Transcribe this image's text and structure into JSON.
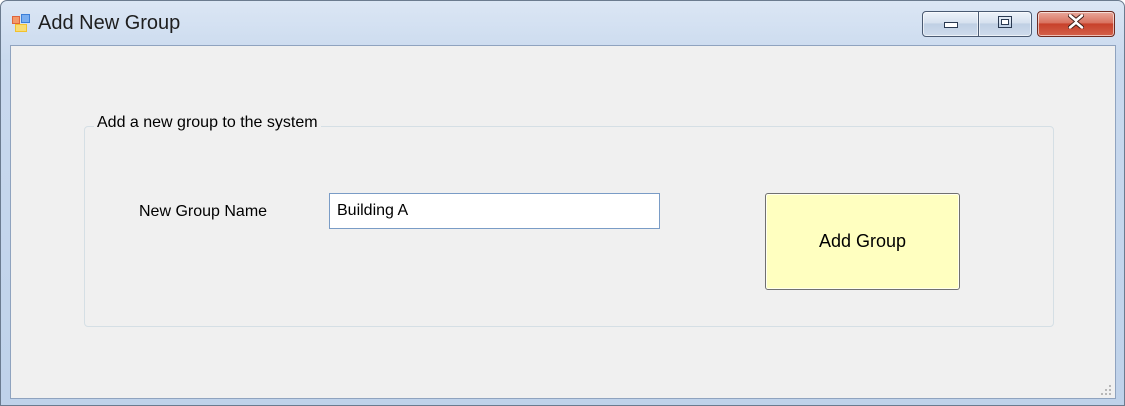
{
  "window": {
    "title": "Add New Group"
  },
  "title_buttons": {
    "minimize_icon": "minimize-icon",
    "maximize_icon": "maximize-icon",
    "close_icon": "close-icon"
  },
  "groupbox": {
    "legend": "Add a new group to the system"
  },
  "form": {
    "group_name_label": "New Group Name",
    "group_name_value": "Building A"
  },
  "actions": {
    "add_group_label": "Add Group"
  },
  "colors": {
    "button_background": "#ffffc0",
    "client_background": "#f0f0f0",
    "close_button": "#c7412b"
  }
}
